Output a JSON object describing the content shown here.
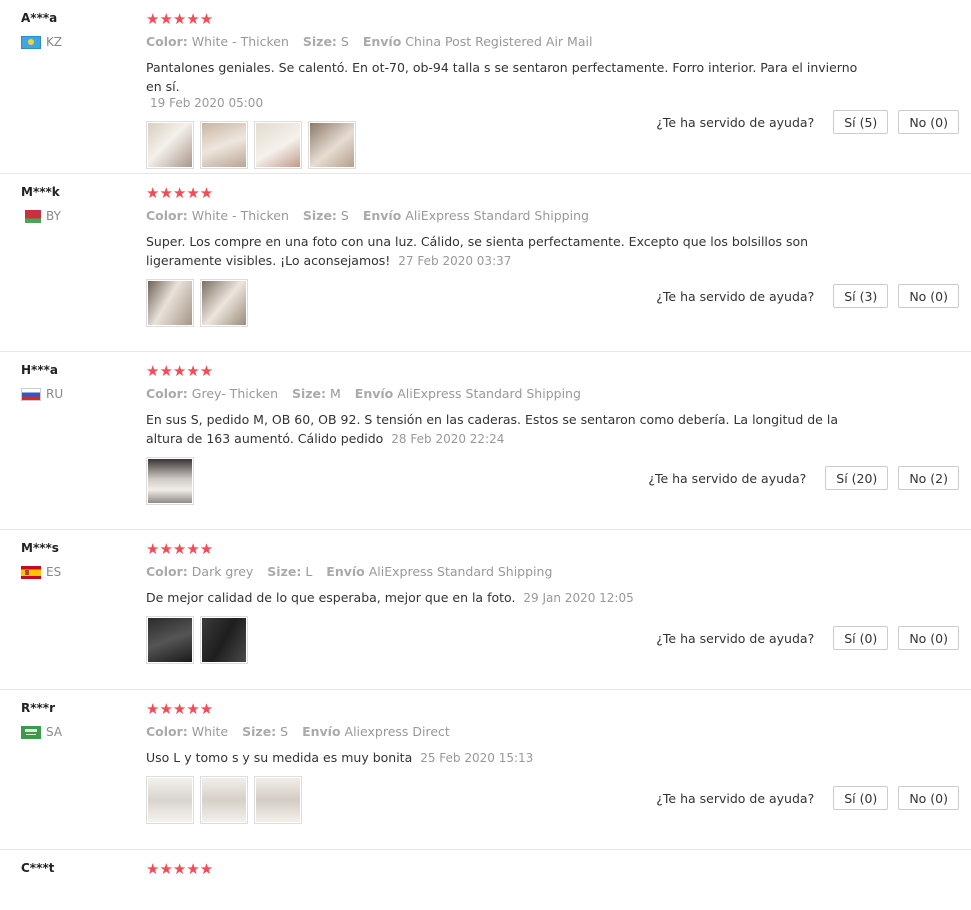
{
  "help_question": "¿Te ha servido de ayuda?",
  "labels": {
    "color": "Color:",
    "size": "Size:",
    "shipping": "Envío"
  },
  "stars": "★★★★★",
  "reviews": [
    {
      "user": "A***a",
      "country": "KZ",
      "color": "White - Thicken",
      "size": "S",
      "shipping": "China Post Registered Air Mail",
      "text": "Pantalones geniales. Se calentó. En ot-70, ob-94 talla s se sentaron perfectamente. Forro interior. Para el invierno en sí.",
      "date": "19 Feb 2020 05:00",
      "yes": "Sí (5)",
      "no": "No (0)"
    },
    {
      "user": "M***k",
      "country": "BY",
      "color": "White - Thicken",
      "size": "S",
      "shipping": "AliExpress Standard Shipping",
      "text": "Super. Los compre en una foto con una luz. Cálido, se sienta perfectamente. Excepto que los bolsillos son ligeramente visibles. ¡Lo aconsejamos!",
      "date": "27 Feb 2020 03:37",
      "yes": "Sí (3)",
      "no": "No (0)"
    },
    {
      "user": "H***a",
      "country": "RU",
      "color": "Grey- Thicken",
      "size": "M",
      "shipping": "AliExpress Standard Shipping",
      "text": "En sus S, pedido M, OB 60, OB 92. S tensión en las caderas. Estos se sentaron como debería. La longitud de la altura de 163 aumentó. Cálido pedido",
      "date": "28 Feb 2020 22:24",
      "yes": "Sí (20)",
      "no": "No (2)"
    },
    {
      "user": "M***s",
      "country": "ES",
      "color": "Dark grey",
      "size": "L",
      "shipping": "AliExpress Standard Shipping",
      "text": "De mejor calidad de lo que esperaba, mejor que en la foto.",
      "date": "29 Jan 2020 12:05",
      "yes": "Sí (0)",
      "no": "No (0)"
    },
    {
      "user": "R***r",
      "country": "SA",
      "color": "White",
      "size": "S",
      "shipping": "Aliexpress Direct",
      "text": "Uso L y tomo s y su medida es muy bonita",
      "date": "25 Feb 2020 15:13",
      "yes": "Sí (0)",
      "no": "No (0)"
    },
    {
      "user": "C***t"
    }
  ],
  "colors": {
    "star": "#f44b54",
    "divider": "#e8e8e8"
  }
}
